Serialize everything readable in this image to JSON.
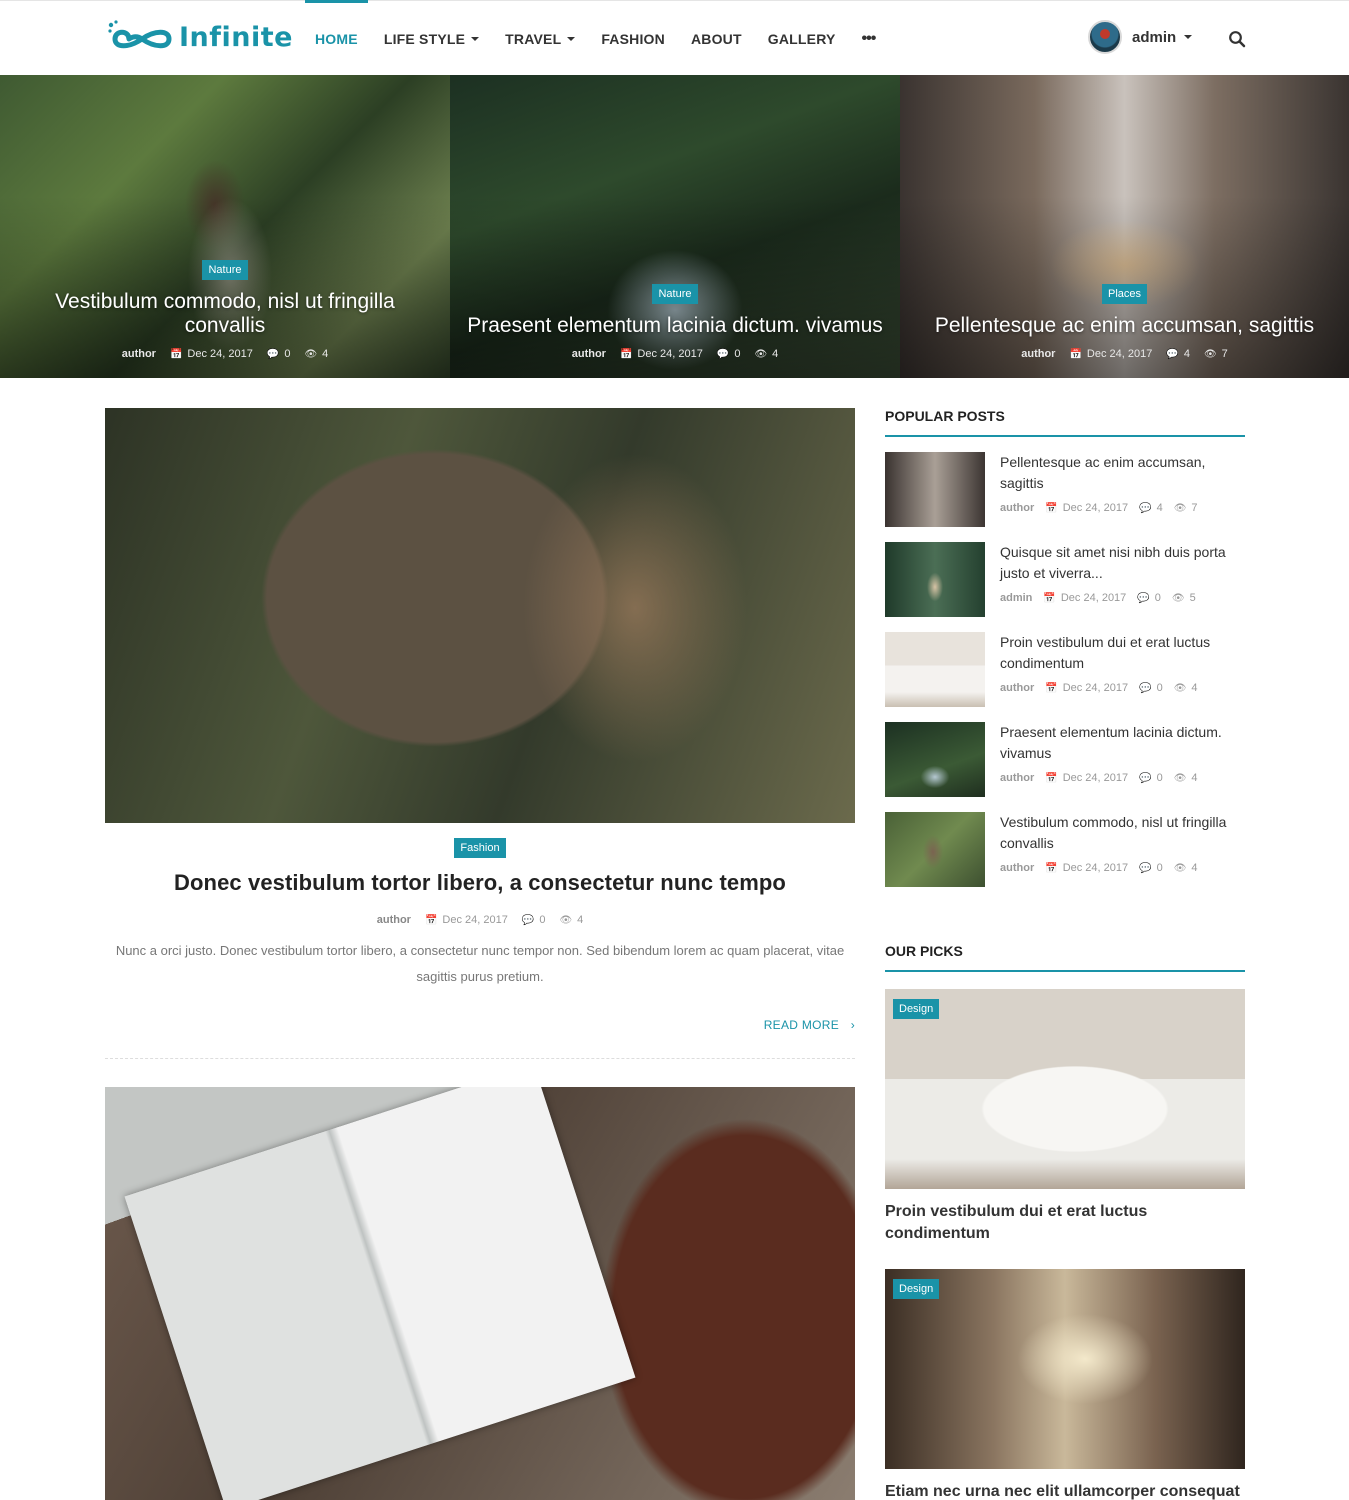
{
  "brand": {
    "name": "Infinite",
    "accent": "#1a93a8"
  },
  "nav": [
    {
      "label": "HOME",
      "active": true
    },
    {
      "label": "LIFE STYLE",
      "dropdown": true
    },
    {
      "label": "TRAVEL",
      "dropdown": true
    },
    {
      "label": "FASHION"
    },
    {
      "label": "ABOUT"
    },
    {
      "label": "GALLERY"
    },
    {
      "label": "•••"
    }
  ],
  "user": {
    "name": "admin"
  },
  "hero": [
    {
      "category": "Nature",
      "title": "Vestibulum commodo, nisl ut fringilla convallis",
      "author": "author",
      "date": "Dec 24, 2017",
      "comments": "0",
      "views": "4"
    },
    {
      "category": "Nature",
      "title": "Praesent elementum lacinia dictum. vivamus",
      "author": "author",
      "date": "Dec 24, 2017",
      "comments": "0",
      "views": "4"
    },
    {
      "category": "Places",
      "title": "Pellentesque ac enim accumsan, sagittis",
      "author": "author",
      "date": "Dec 24, 2017",
      "comments": "4",
      "views": "7"
    }
  ],
  "posts": [
    {
      "category": "Fashion",
      "title": "Donec vestibulum tortor libero, a consectetur nunc tempo",
      "author": "author",
      "date": "Dec 24, 2017",
      "comments": "0",
      "views": "4",
      "excerpt": "Nunc a orci justo. Donec vestibulum tortor libero, a consectetur nunc tempor non. Sed bibendum lorem ac quam placerat, vitae sagittis purus pretium.",
      "read_more": "READ MORE"
    }
  ],
  "sidebar": {
    "popular_title": "POPULAR POSTS",
    "popular": [
      {
        "title": "Pellentesque ac enim accumsan, sagittis",
        "author": "author",
        "date": "Dec 24, 2017",
        "comments": "4",
        "views": "7"
      },
      {
        "title": "Quisque sit amet nisi nibh duis porta justo et viverra...",
        "author": "admin",
        "date": "Dec 24, 2017",
        "comments": "0",
        "views": "5"
      },
      {
        "title": "Proin vestibulum dui et erat luctus condimentum",
        "author": "author",
        "date": "Dec 24, 2017",
        "comments": "0",
        "views": "4"
      },
      {
        "title": "Praesent elementum lacinia dictum. vivamus",
        "author": "author",
        "date": "Dec 24, 2017",
        "comments": "0",
        "views": "4"
      },
      {
        "title": "Vestibulum commodo, nisl ut fringilla convallis",
        "author": "author",
        "date": "Dec 24, 2017",
        "comments": "0",
        "views": "4"
      }
    ],
    "picks_title": "OUR PICKS",
    "picks": [
      {
        "category": "Design",
        "title": "Proin vestibulum dui et erat luctus condimentum"
      },
      {
        "category": "Design",
        "title": "Etiam nec urna nec elit ullamcorper consequat vel id ligula"
      }
    ]
  }
}
